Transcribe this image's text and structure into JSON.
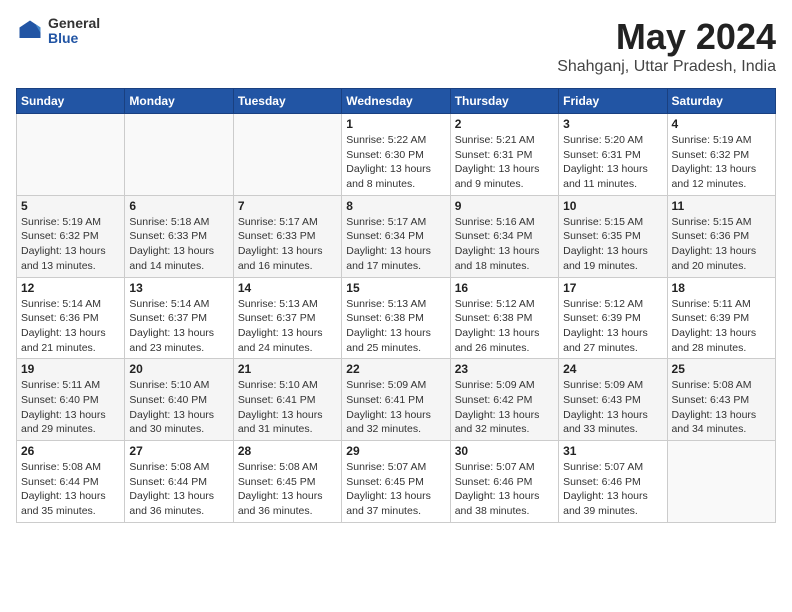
{
  "logo": {
    "general": "General",
    "blue": "Blue"
  },
  "title": {
    "month": "May 2024",
    "location": "Shahganj, Uttar Pradesh, India"
  },
  "days_header": [
    "Sunday",
    "Monday",
    "Tuesday",
    "Wednesday",
    "Thursday",
    "Friday",
    "Saturday"
  ],
  "weeks": [
    [
      {
        "day": "",
        "info": ""
      },
      {
        "day": "",
        "info": ""
      },
      {
        "day": "",
        "info": ""
      },
      {
        "day": "1",
        "info": "Sunrise: 5:22 AM\nSunset: 6:30 PM\nDaylight: 13 hours and 8 minutes."
      },
      {
        "day": "2",
        "info": "Sunrise: 5:21 AM\nSunset: 6:31 PM\nDaylight: 13 hours and 9 minutes."
      },
      {
        "day": "3",
        "info": "Sunrise: 5:20 AM\nSunset: 6:31 PM\nDaylight: 13 hours and 11 minutes."
      },
      {
        "day": "4",
        "info": "Sunrise: 5:19 AM\nSunset: 6:32 PM\nDaylight: 13 hours and 12 minutes."
      }
    ],
    [
      {
        "day": "5",
        "info": "Sunrise: 5:19 AM\nSunset: 6:32 PM\nDaylight: 13 hours and 13 minutes."
      },
      {
        "day": "6",
        "info": "Sunrise: 5:18 AM\nSunset: 6:33 PM\nDaylight: 13 hours and 14 minutes."
      },
      {
        "day": "7",
        "info": "Sunrise: 5:17 AM\nSunset: 6:33 PM\nDaylight: 13 hours and 16 minutes."
      },
      {
        "day": "8",
        "info": "Sunrise: 5:17 AM\nSunset: 6:34 PM\nDaylight: 13 hours and 17 minutes."
      },
      {
        "day": "9",
        "info": "Sunrise: 5:16 AM\nSunset: 6:34 PM\nDaylight: 13 hours and 18 minutes."
      },
      {
        "day": "10",
        "info": "Sunrise: 5:15 AM\nSunset: 6:35 PM\nDaylight: 13 hours and 19 minutes."
      },
      {
        "day": "11",
        "info": "Sunrise: 5:15 AM\nSunset: 6:36 PM\nDaylight: 13 hours and 20 minutes."
      }
    ],
    [
      {
        "day": "12",
        "info": "Sunrise: 5:14 AM\nSunset: 6:36 PM\nDaylight: 13 hours and 21 minutes."
      },
      {
        "day": "13",
        "info": "Sunrise: 5:14 AM\nSunset: 6:37 PM\nDaylight: 13 hours and 23 minutes."
      },
      {
        "day": "14",
        "info": "Sunrise: 5:13 AM\nSunset: 6:37 PM\nDaylight: 13 hours and 24 minutes."
      },
      {
        "day": "15",
        "info": "Sunrise: 5:13 AM\nSunset: 6:38 PM\nDaylight: 13 hours and 25 minutes."
      },
      {
        "day": "16",
        "info": "Sunrise: 5:12 AM\nSunset: 6:38 PM\nDaylight: 13 hours and 26 minutes."
      },
      {
        "day": "17",
        "info": "Sunrise: 5:12 AM\nSunset: 6:39 PM\nDaylight: 13 hours and 27 minutes."
      },
      {
        "day": "18",
        "info": "Sunrise: 5:11 AM\nSunset: 6:39 PM\nDaylight: 13 hours and 28 minutes."
      }
    ],
    [
      {
        "day": "19",
        "info": "Sunrise: 5:11 AM\nSunset: 6:40 PM\nDaylight: 13 hours and 29 minutes."
      },
      {
        "day": "20",
        "info": "Sunrise: 5:10 AM\nSunset: 6:40 PM\nDaylight: 13 hours and 30 minutes."
      },
      {
        "day": "21",
        "info": "Sunrise: 5:10 AM\nSunset: 6:41 PM\nDaylight: 13 hours and 31 minutes."
      },
      {
        "day": "22",
        "info": "Sunrise: 5:09 AM\nSunset: 6:41 PM\nDaylight: 13 hours and 32 minutes."
      },
      {
        "day": "23",
        "info": "Sunrise: 5:09 AM\nSunset: 6:42 PM\nDaylight: 13 hours and 32 minutes."
      },
      {
        "day": "24",
        "info": "Sunrise: 5:09 AM\nSunset: 6:43 PM\nDaylight: 13 hours and 33 minutes."
      },
      {
        "day": "25",
        "info": "Sunrise: 5:08 AM\nSunset: 6:43 PM\nDaylight: 13 hours and 34 minutes."
      }
    ],
    [
      {
        "day": "26",
        "info": "Sunrise: 5:08 AM\nSunset: 6:44 PM\nDaylight: 13 hours and 35 minutes."
      },
      {
        "day": "27",
        "info": "Sunrise: 5:08 AM\nSunset: 6:44 PM\nDaylight: 13 hours and 36 minutes."
      },
      {
        "day": "28",
        "info": "Sunrise: 5:08 AM\nSunset: 6:45 PM\nDaylight: 13 hours and 36 minutes."
      },
      {
        "day": "29",
        "info": "Sunrise: 5:07 AM\nSunset: 6:45 PM\nDaylight: 13 hours and 37 minutes."
      },
      {
        "day": "30",
        "info": "Sunrise: 5:07 AM\nSunset: 6:46 PM\nDaylight: 13 hours and 38 minutes."
      },
      {
        "day": "31",
        "info": "Sunrise: 5:07 AM\nSunset: 6:46 PM\nDaylight: 13 hours and 39 minutes."
      },
      {
        "day": "",
        "info": ""
      }
    ]
  ]
}
